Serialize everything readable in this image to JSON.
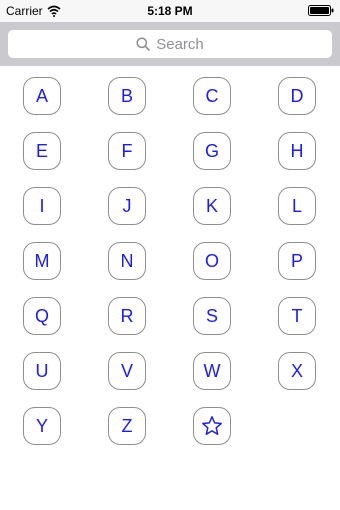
{
  "status_bar": {
    "carrier": "Carrier",
    "time": "5:18 PM"
  },
  "search": {
    "placeholder": "Search"
  },
  "index_keys": [
    "A",
    "B",
    "C",
    "D",
    "E",
    "F",
    "G",
    "H",
    "I",
    "J",
    "K",
    "L",
    "M",
    "N",
    "O",
    "P",
    "Q",
    "R",
    "S",
    "T",
    "U",
    "V",
    "W",
    "X",
    "Y",
    "Z"
  ],
  "favorites_key_icon": "star-icon",
  "colors": {
    "key_text": "#1a1aff",
    "key_border": "#8e8e93",
    "search_background": "#c9c9ce"
  }
}
